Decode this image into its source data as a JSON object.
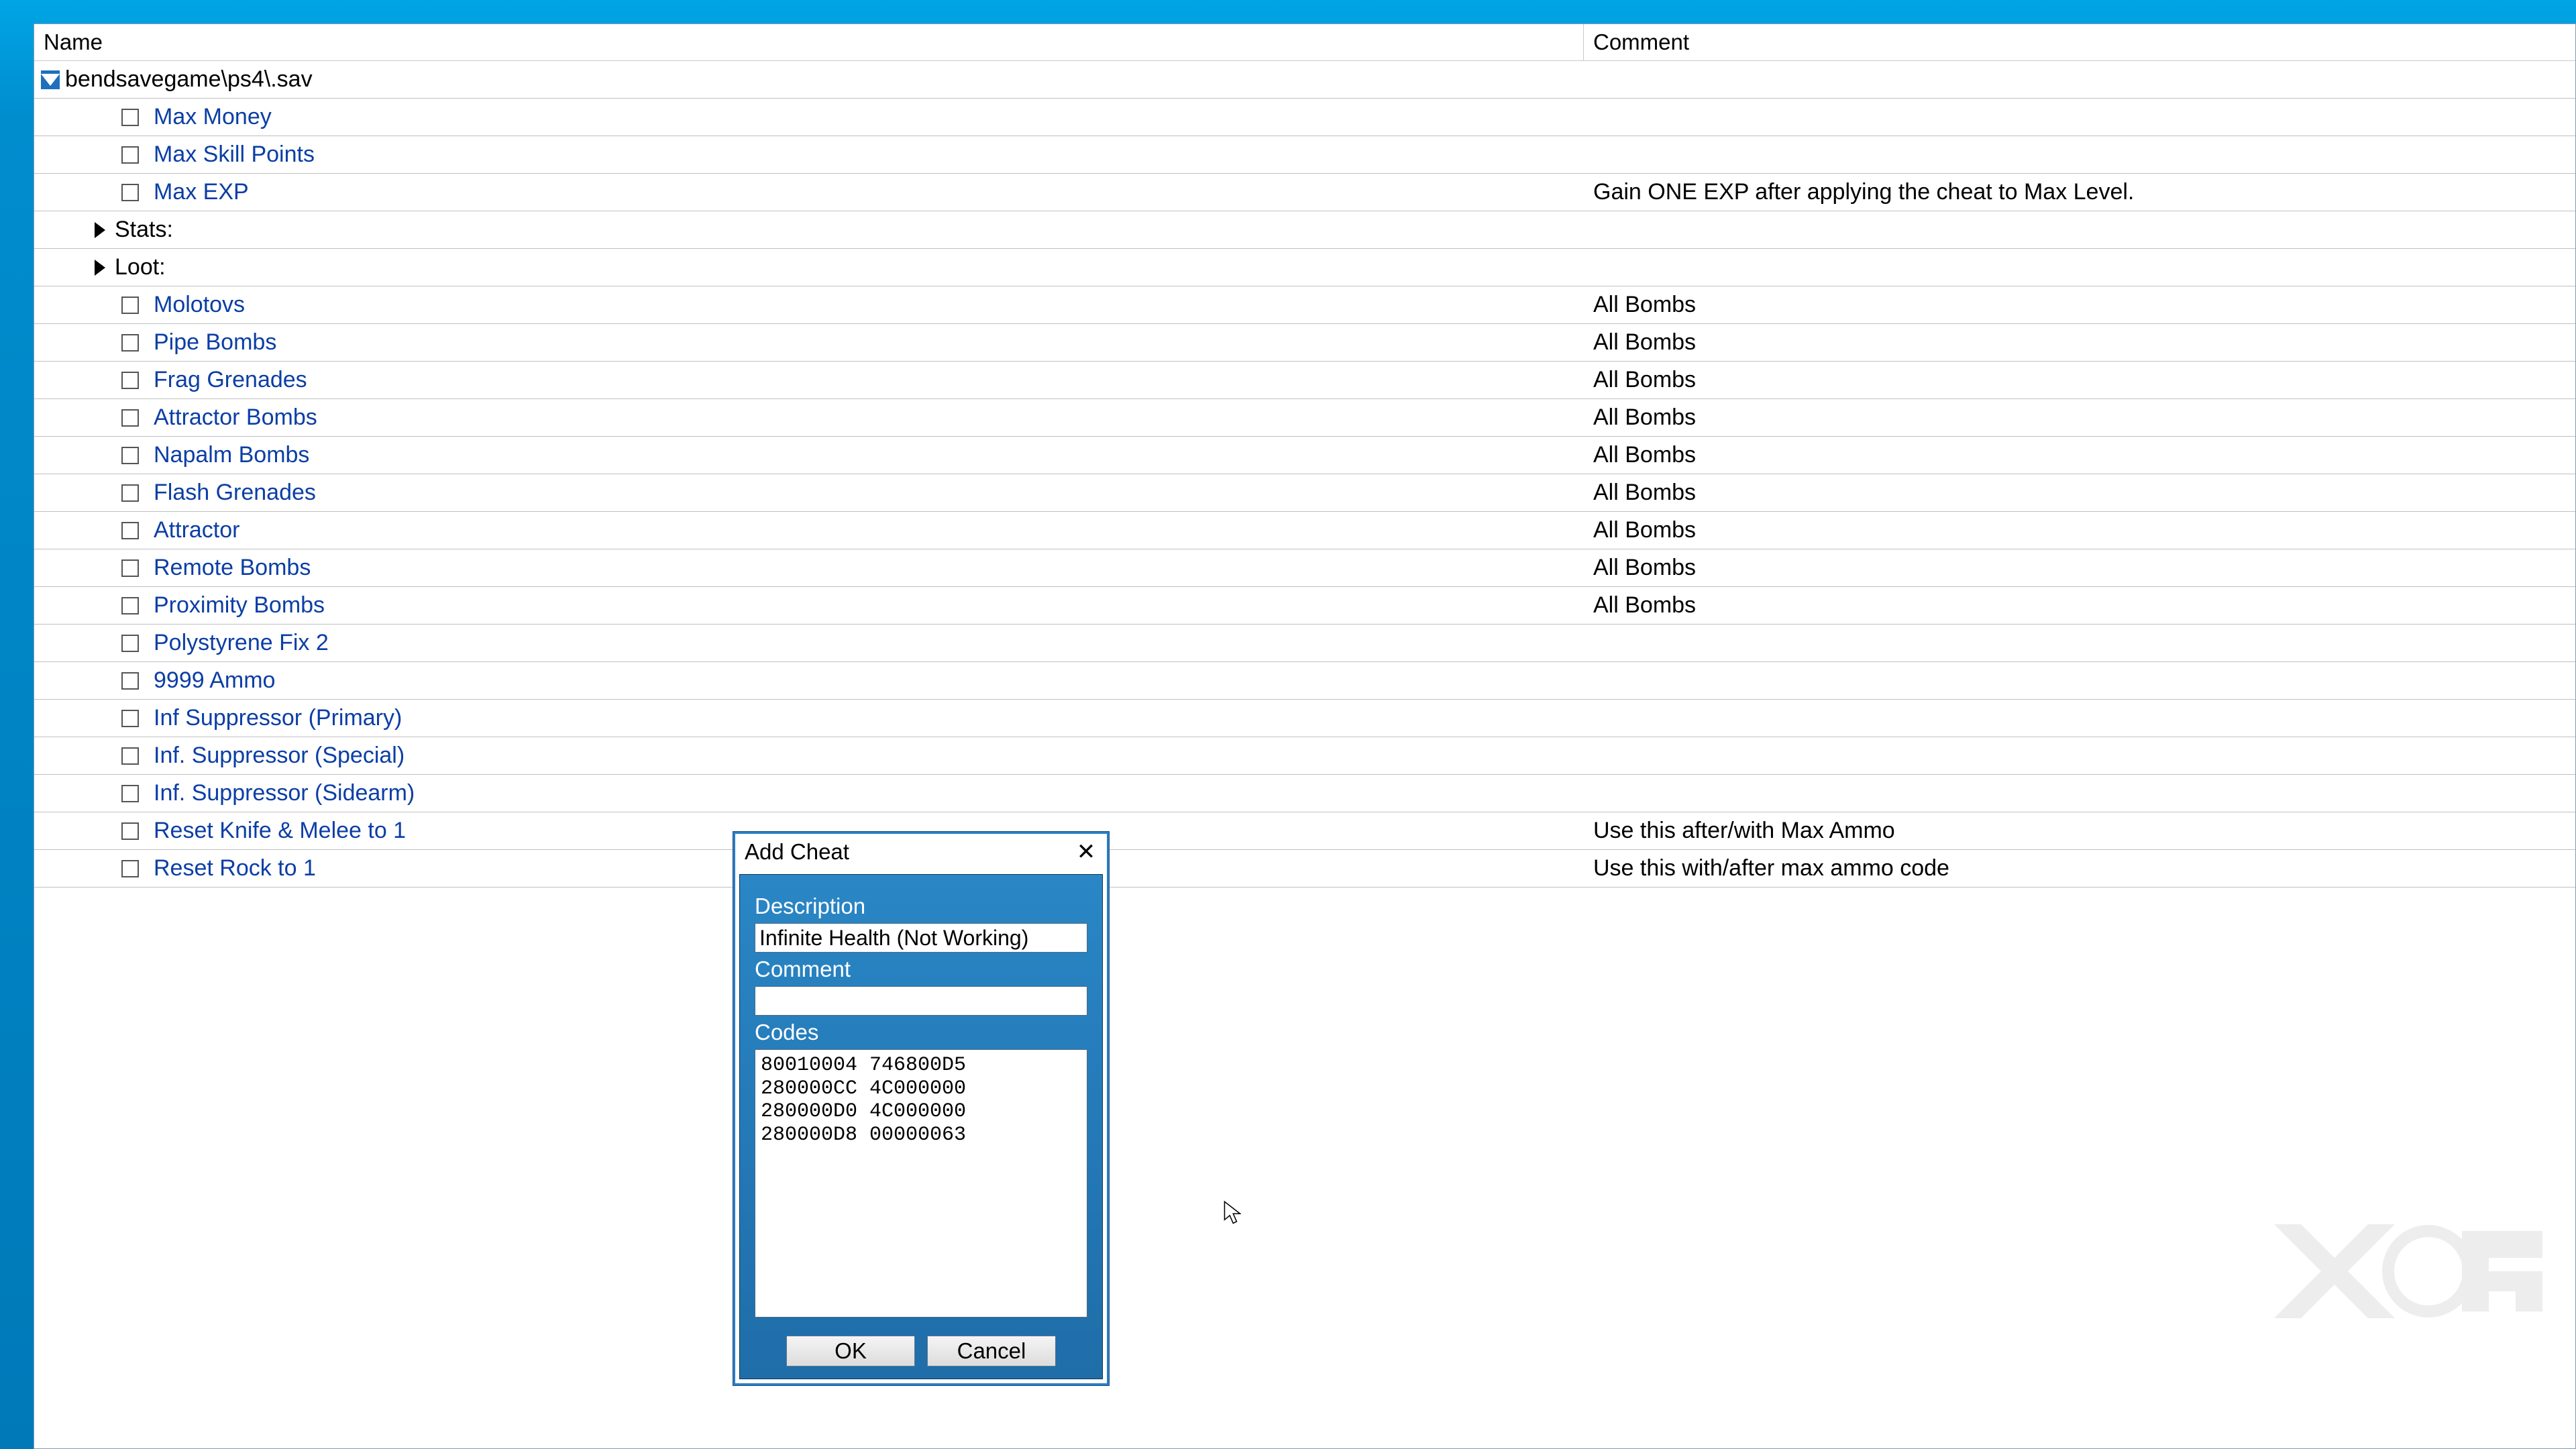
{
  "header": {
    "name": "Name",
    "comment": "Comment"
  },
  "root": {
    "label": "bendsavegame\\ps4\\.sav"
  },
  "rows": [
    {
      "type": "item",
      "indent": 2,
      "label": "Max Money",
      "comment": "",
      "link": true
    },
    {
      "type": "item",
      "indent": 2,
      "label": "Max Skill Points",
      "comment": "",
      "link": true
    },
    {
      "type": "item",
      "indent": 2,
      "label": "Max EXP",
      "comment": "Gain ONE EXP after applying the cheat to Max Level.",
      "link": true
    },
    {
      "type": "group",
      "indent": 1,
      "label": "Stats:"
    },
    {
      "type": "group",
      "indent": 1,
      "label": "Loot:"
    },
    {
      "type": "item",
      "indent": 2,
      "label": "Molotovs",
      "comment": "All Bombs",
      "link": true
    },
    {
      "type": "item",
      "indent": 2,
      "label": "Pipe Bombs",
      "comment": "All Bombs",
      "link": true
    },
    {
      "type": "item",
      "indent": 2,
      "label": "Frag Grenades",
      "comment": "All Bombs",
      "link": true
    },
    {
      "type": "item",
      "indent": 2,
      "label": "Attractor Bombs",
      "comment": "All Bombs",
      "link": true
    },
    {
      "type": "item",
      "indent": 2,
      "label": "Napalm Bombs",
      "comment": "All Bombs",
      "link": true
    },
    {
      "type": "item",
      "indent": 2,
      "label": "Flash Grenades",
      "comment": "All Bombs",
      "link": true
    },
    {
      "type": "item",
      "indent": 2,
      "label": "Attractor",
      "comment": "All Bombs",
      "link": true
    },
    {
      "type": "item",
      "indent": 2,
      "label": "Remote Bombs",
      "comment": "All Bombs",
      "link": true
    },
    {
      "type": "item",
      "indent": 2,
      "label": "Proximity Bombs",
      "comment": "All Bombs",
      "link": true
    },
    {
      "type": "item",
      "indent": 2,
      "label": "Polystyrene Fix 2",
      "comment": "",
      "link": true
    },
    {
      "type": "item",
      "indent": 2,
      "label": "9999 Ammo",
      "comment": "",
      "link": true
    },
    {
      "type": "item",
      "indent": 2,
      "label": "Inf Suppressor (Primary)",
      "comment": "",
      "link": true
    },
    {
      "type": "item",
      "indent": 2,
      "label": "Inf. Suppressor (Special)",
      "comment": "",
      "link": true
    },
    {
      "type": "item",
      "indent": 2,
      "label": "Inf. Suppressor (Sidearm)",
      "comment": "",
      "link": true
    },
    {
      "type": "item",
      "indent": 2,
      "label": "Reset Knife & Melee to 1",
      "comment": "Use this after/with Max Ammo",
      "link": true
    },
    {
      "type": "item",
      "indent": 2,
      "label": "Reset Rock to 1",
      "comment": "Use this with/after max ammo code",
      "link": true
    }
  ],
  "dialog": {
    "title": "Add Cheat",
    "description_label": "Description",
    "description_value": "Infinite Health (Not Working)",
    "comment_label": "Comment",
    "comment_value": "",
    "codes_label": "Codes",
    "codes_value": "80010004 746800D5\n280000CC 4C000000\n280000D0 4C000000\n280000D8 00000063",
    "ok": "OK",
    "cancel": "Cancel"
  }
}
